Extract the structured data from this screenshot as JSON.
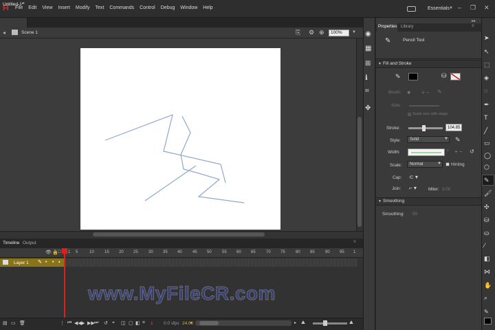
{
  "app": {
    "logo": "Fl",
    "workspace": "Essentials"
  },
  "menu": [
    "File",
    "Edit",
    "View",
    "Insert",
    "Modify",
    "Text",
    "Commands",
    "Control",
    "Debug",
    "Window",
    "Help"
  ],
  "document": {
    "tab_title": "Untitled-1*",
    "scene": "Scene 1",
    "zoom": "100%"
  },
  "timeline": {
    "tabs": [
      "Timeline",
      "Output"
    ],
    "frame_numbers": [
      "1",
      "5",
      "10",
      "15",
      "20",
      "25",
      "30",
      "35",
      "40",
      "45",
      "50",
      "55",
      "60",
      "65",
      "70",
      "75",
      "80",
      "85",
      "90",
      "95",
      "1"
    ],
    "layer_name": "Layer 1",
    "current_frame": "1",
    "time": "0.0 s",
    "fps": "24.00",
    "fps_unit": "fps"
  },
  "properties": {
    "tabs": [
      "Properties",
      "Library"
    ],
    "tool_name": "Pencil Tool",
    "fill_and_stroke_title": "Fill and Stroke",
    "brush_label": "Brush:",
    "size_label": "Size:",
    "lock_label": "Scale size with stage",
    "stroke_label": "Stroke:",
    "stroke_value": "104.85",
    "style_label": "Style:",
    "style_value": "Solid",
    "width_label": "Width:",
    "scale_label": "Scale:",
    "scale_value": "Normal",
    "hinting_label": "Hinting",
    "cap_label": "Cap:",
    "join_label": "Join:",
    "miter_label": "Miter:",
    "miter_value": "3.00",
    "smoothing_title": "Smoothing",
    "smoothing_label": "Smoothing:",
    "smoothing_value": "50",
    "stroke_color": "#000000"
  },
  "watermark": "www.MyFileCR.com",
  "colors": {
    "stroke_line": "#8fa6d0",
    "layer_highlight": "#8a7418",
    "playhead": "#e01e1e"
  }
}
